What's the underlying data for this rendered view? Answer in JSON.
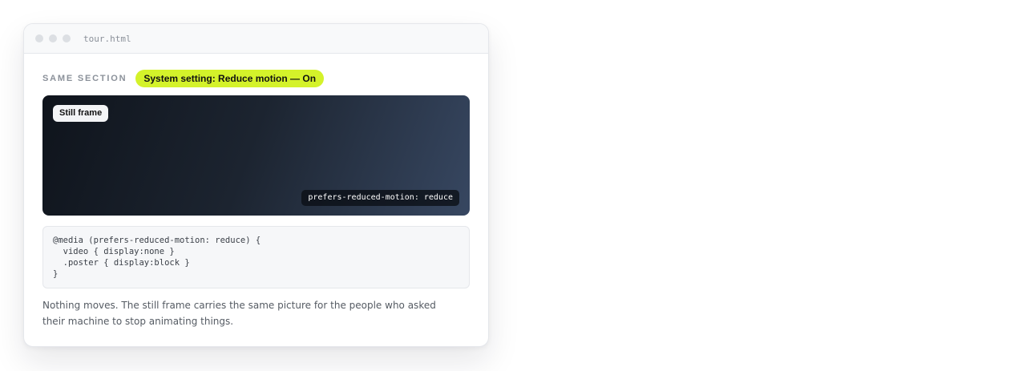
{
  "window": {
    "filename": "tour.html"
  },
  "section": {
    "label": "SAME SECTION",
    "setting_pill": "System setting: Reduce motion — On"
  },
  "frame": {
    "badge": "Still frame",
    "media_query_chip": "prefers-reduced-motion: reduce"
  },
  "code": {
    "lines": [
      "@media (prefers-reduced-motion: reduce) {",
      "  video { display:none }",
      "  .poster { display:block }",
      "}"
    ]
  },
  "description": "Nothing moves. The still frame carries the same picture for the people who asked their machine to stop animating things.",
  "colors": {
    "pill_accent": "#d4f22a",
    "frame_dark": "#0f141c",
    "frame_light": "#374761"
  }
}
